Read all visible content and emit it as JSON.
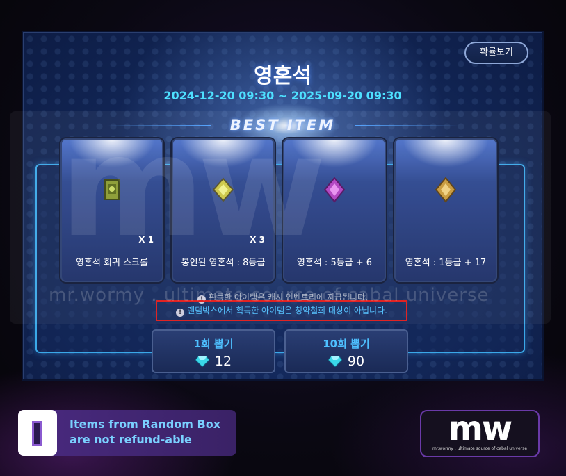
{
  "window": {
    "title": "영혼석",
    "period": "2024-12-20 09:30 ~ 2025-09-20 09:30",
    "probability_button": "확률보기",
    "best_label": "BEST ITEM"
  },
  "items": [
    {
      "name": "영혼석 회귀 스크롤",
      "qty": "X 1",
      "icon": "green-scroll-icon"
    },
    {
      "name": "봉인된 영혼석 : 8등급",
      "qty": "X 3",
      "icon": "yellow-soulstone-icon"
    },
    {
      "name": "영혼석 : 5등급 + 6",
      "qty": "",
      "icon": "purple-soulstone-icon"
    },
    {
      "name": "영혼석 : 1등급 + 17",
      "qty": "",
      "icon": "gold-soulstone-icon"
    }
  ],
  "notices": {
    "line1": "획득한 아이템은 캐시 인벤토리에 지급됩니다.",
    "line2": "랜덤박스에서 획득한 아이템은 청약철회 대상이 아닙니다."
  },
  "draw": [
    {
      "label": "1회 뽑기",
      "cost": "12"
    },
    {
      "label": "10회 뽑기",
      "cost": "90"
    }
  ],
  "watermark": {
    "big": "mw",
    "text": "mr.wormy . ultimate source of cabal universe"
  },
  "bottom_note": {
    "line1": "Items from Random Box",
    "line2": "are not refund-able"
  },
  "logo": {
    "mark": "mw",
    "sub": "mr.wormy . ultimate source of cabal universe"
  },
  "colors": {
    "accent_cyan": "#4ec0ff",
    "highlight_red": "#e01818",
    "brand_purple": "#6a3aa8"
  }
}
